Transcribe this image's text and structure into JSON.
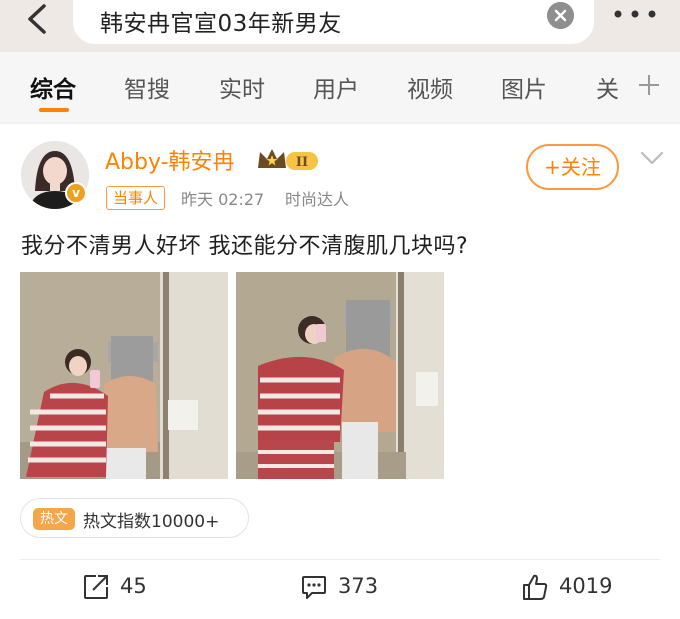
{
  "search": {
    "query": "韩安冉官宣03年新男友"
  },
  "tabs": [
    "综合",
    "智搜",
    "实时",
    "用户",
    "视频",
    "图片",
    "关"
  ],
  "post": {
    "username": "Abby-韩安冉",
    "level_label": "II",
    "role_tag": "当事人",
    "time": "昨天 02:27",
    "source": "时尚达人",
    "follow_label": "+关注",
    "text": "我分不清男人好坏 我还能分不清腹肌几块吗?",
    "hot_badge": "热文",
    "hot_index": "热文指数10000+"
  },
  "actions": {
    "repost": "45",
    "comment": "373",
    "like": "4019"
  },
  "colors": {
    "accent": "#ff8200",
    "hot_badge": "#f4a64a"
  }
}
